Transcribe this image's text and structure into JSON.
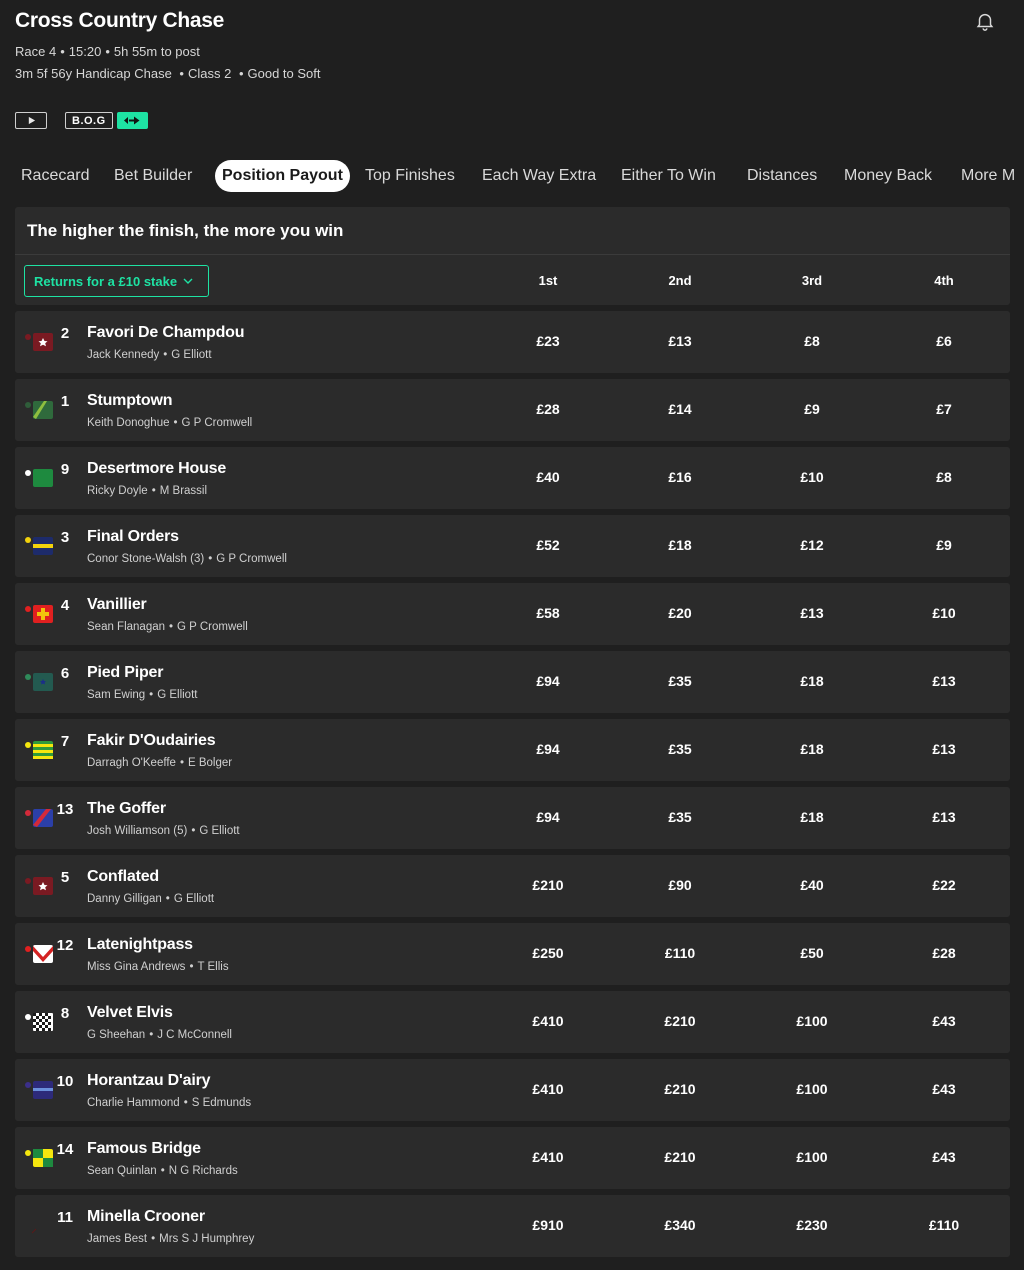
{
  "race": {
    "title": "Cross Country Chase",
    "meta_parts": [
      "Race 4",
      "15:20",
      "5h 55m to post"
    ],
    "details_parts": [
      "3m 5f 56y Handicap Chase",
      "Class 2",
      "Good to Soft"
    ]
  },
  "badges": {
    "bog": "B.O.G"
  },
  "tabs": [
    {
      "label": "Racecard",
      "active": false
    },
    {
      "label": "Bet Builder",
      "active": false
    },
    {
      "label": "Position Payout",
      "active": true
    },
    {
      "label": "Top Finishes",
      "active": false
    },
    {
      "label": "Each Way Extra",
      "active": false
    },
    {
      "label": "Either To Win",
      "active": false
    },
    {
      "label": "Distances",
      "active": false
    },
    {
      "label": "Money Back",
      "active": false
    },
    {
      "label": "More M",
      "active": false
    }
  ],
  "panel": {
    "heading": "The higher the finish, the more you win",
    "stake_label": "Returns for a £10 stake",
    "columns": [
      "1st",
      "2nd",
      "3rd",
      "4th"
    ]
  },
  "colors": {
    "accent": "#1ee2a3",
    "background": "#1f1f1f",
    "card": "#2b2b2b"
  },
  "runners": [
    {
      "num": "2",
      "name": "Favori De Champdou",
      "jockey": "Jack Kennedy",
      "trainer": "G Elliott",
      "returns": [
        "£23",
        "£13",
        "£8",
        "£6"
      ],
      "silk": "maroon-star"
    },
    {
      "num": "1",
      "name": "Stumptown",
      "jockey": "Keith Donoghue",
      "trainer": "G P Cromwell",
      "returns": [
        "£28",
        "£14",
        "£9",
        "£7"
      ],
      "silk": "green-sash"
    },
    {
      "num": "9",
      "name": "Desertmore House",
      "jockey": "Ricky Doyle",
      "trainer": "M Brassil",
      "returns": [
        "£40",
        "£16",
        "£10",
        "£8"
      ],
      "silk": "green-plain"
    },
    {
      "num": "3",
      "name": "Final Orders",
      "jockey": "Conor Stone-Walsh (3)",
      "trainer": "G P Cromwell",
      "returns": [
        "£52",
        "£18",
        "£12",
        "£9"
      ],
      "silk": "navy-yellow"
    },
    {
      "num": "4",
      "name": "Vanillier",
      "jockey": "Sean Flanagan",
      "trainer": "G P Cromwell",
      "returns": [
        "£58",
        "£20",
        "£13",
        "£10"
      ],
      "silk": "red-cross"
    },
    {
      "num": "6",
      "name": "Pied Piper",
      "jockey": "Sam Ewing",
      "trainer": "G Elliott",
      "returns": [
        "£94",
        "£35",
        "£18",
        "£13"
      ],
      "silk": "teal-star"
    },
    {
      "num": "7",
      "name": "Fakir D'Oudairies",
      "jockey": "Darragh O'Keeffe",
      "trainer": "E Bolger",
      "returns": [
        "£94",
        "£35",
        "£18",
        "£13"
      ],
      "silk": "green-yellow"
    },
    {
      "num": "13",
      "name": "The Goffer",
      "jockey": "Josh Williamson (5)",
      "trainer": "G Elliott",
      "returns": [
        "£94",
        "£35",
        "£18",
        "£13"
      ],
      "silk": "blue-red"
    },
    {
      "num": "5",
      "name": "Conflated",
      "jockey": "Danny Gilligan",
      "trainer": "G Elliott",
      "returns": [
        "£210",
        "£90",
        "£40",
        "£22"
      ],
      "silk": "maroon-star"
    },
    {
      "num": "12",
      "name": "Latenightpass",
      "jockey": "Miss Gina Andrews",
      "trainer": "T Ellis",
      "returns": [
        "£250",
        "£110",
        "£50",
        "£28"
      ],
      "silk": "white-red"
    },
    {
      "num": "8",
      "name": "Velvet Elvis",
      "jockey": "G Sheehan",
      "trainer": "J C McConnell",
      "returns": [
        "£410",
        "£210",
        "£100",
        "£43"
      ],
      "silk": "check"
    },
    {
      "num": "10",
      "name": "Horantzau D'airy",
      "jockey": "Charlie Hammond",
      "trainer": "S Edmunds",
      "returns": [
        "£410",
        "£210",
        "£100",
        "£43"
      ],
      "silk": "purple-stripe"
    },
    {
      "num": "14",
      "name": "Famous Bridge",
      "jockey": "Sean Quinlan",
      "trainer": "N G Richards",
      "returns": [
        "£410",
        "£210",
        "£100",
        "£43"
      ],
      "silk": "yellow-green"
    },
    {
      "num": "11",
      "name": "Minella Crooner",
      "jockey": "James Best",
      "trainer": "Mrs S J Humphrey",
      "returns": [
        "£910",
        "£340",
        "£230",
        "£110"
      ],
      "silk": "none"
    }
  ]
}
